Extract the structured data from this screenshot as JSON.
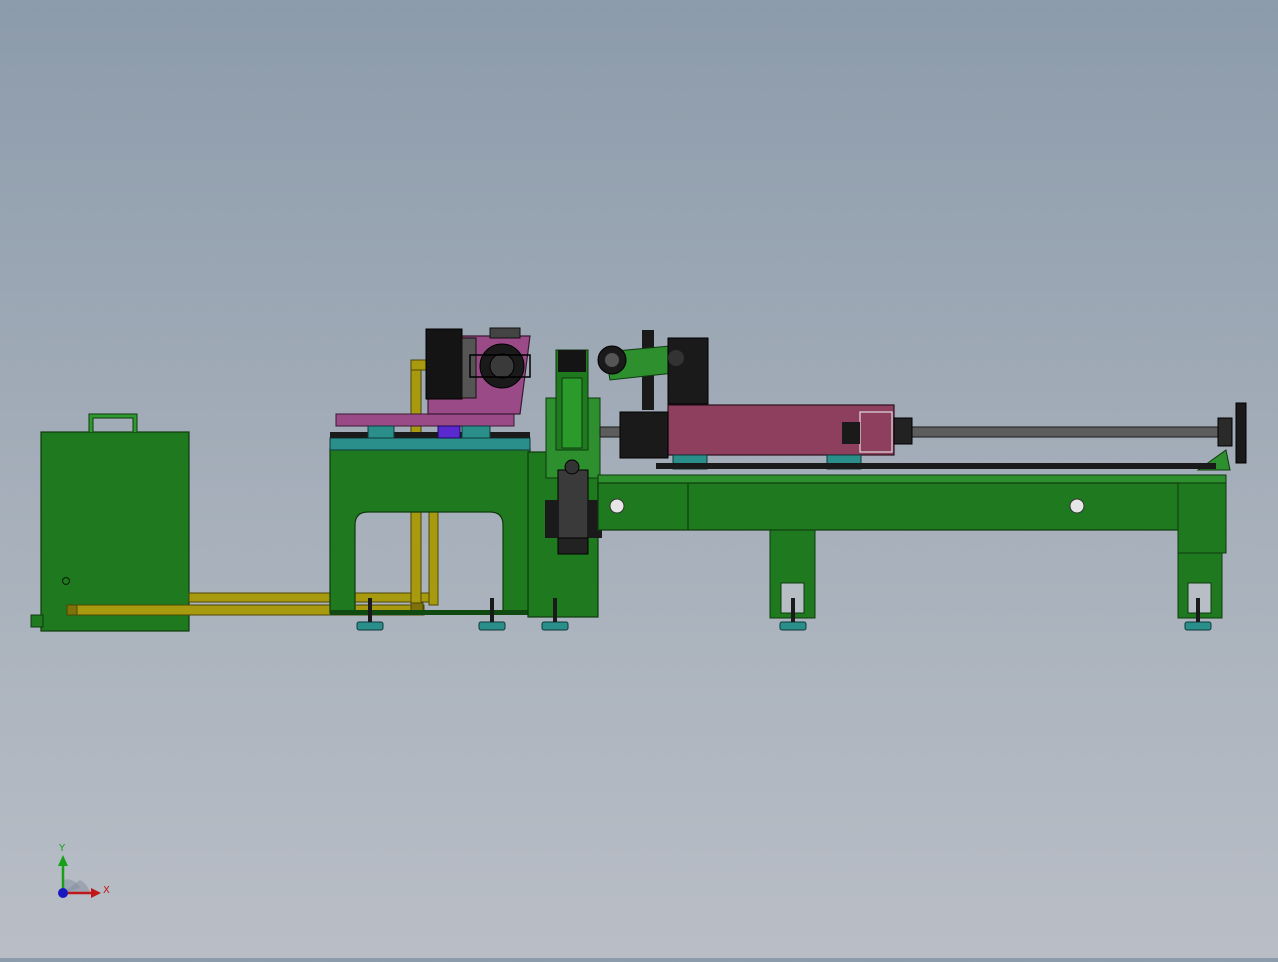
{
  "triad": {
    "y_label": "Y",
    "x_label": "X",
    "icon": "coordinate-triad-icon"
  },
  "colors": {
    "background_top": "#8c9bab",
    "background_bottom": "#b9bec6",
    "frame_green": "#1f7a1f",
    "frame_green_dark": "#0f4a10",
    "carriage_purple": "#9a4a86",
    "carriage_maroon": "#8e3f5e",
    "pipe_yellow": "#a89a0e",
    "rail_teal": "#2a8f8a",
    "black_part": "#141414",
    "axis_x": "#c01818",
    "axis_y": "#18a018",
    "axis_z": "#1818c0"
  }
}
